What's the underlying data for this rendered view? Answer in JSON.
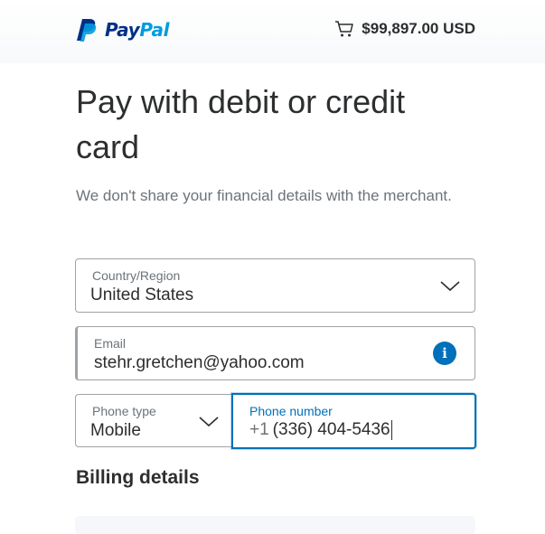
{
  "header": {
    "brand_first": "Pay",
    "brand_second": "Pal",
    "cart_total": "$99,897.00 USD",
    "cart_icon": "cart-icon"
  },
  "main": {
    "title": "Pay with debit or credit card",
    "subtitle": "We don't share your financial details with the merchant."
  },
  "form": {
    "country": {
      "label": "Country/Region",
      "value": "United States"
    },
    "email": {
      "label": "Email",
      "value": "stehr.gretchen@yahoo.com",
      "info_icon": "info-icon"
    },
    "phone_type": {
      "label": "Phone type",
      "value": "Mobile"
    },
    "phone_number": {
      "label": "Phone number",
      "prefix": "+1",
      "value": "(336) 404-5436"
    }
  },
  "billing": {
    "heading": "Billing details"
  },
  "colors": {
    "brand_dark": "#003087",
    "brand_light": "#009cde",
    "focus": "#0070ba",
    "text": "#2c2e2f",
    "muted": "#6c7378"
  }
}
